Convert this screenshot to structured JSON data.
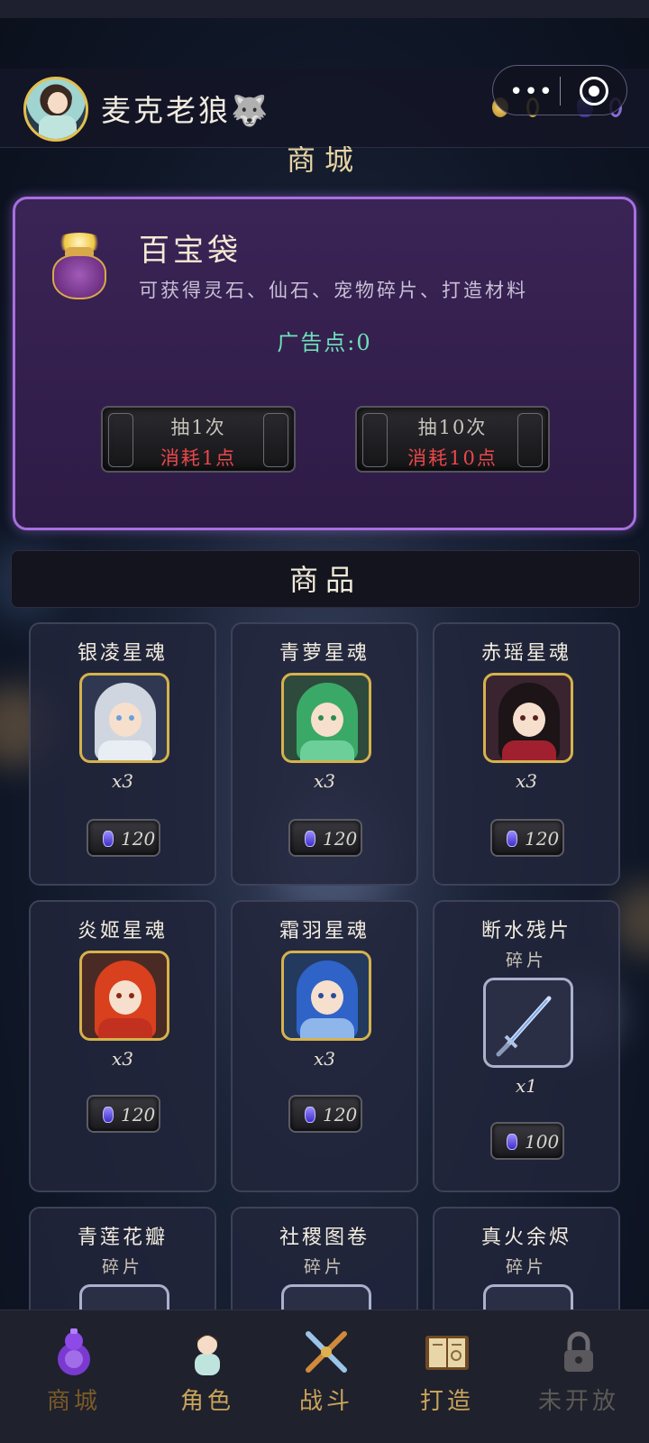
{
  "header": {
    "username": "麦克老狼🐺",
    "page_title": "商城"
  },
  "lucky_bag": {
    "title": "百宝袋",
    "description": "可获得灵石、仙石、宠物碎片、打造材料",
    "ad_points_label": "广告点:0",
    "draw_once": {
      "label": "抽1次",
      "cost": "消耗1点"
    },
    "draw_ten": {
      "label": "抽10次",
      "cost": "消耗10点"
    }
  },
  "goods": {
    "header": "商品",
    "items": [
      {
        "name": "银凌星魂",
        "qty": "x3",
        "price": "120",
        "hair": "#cfd6e0",
        "robe": "#e8eef4",
        "eye": "#6aa0d8"
      },
      {
        "name": "青萝星魂",
        "qty": "x3",
        "price": "120",
        "hair": "#3aa968",
        "robe": "#6ccf9a",
        "eye": "#2f8a4e"
      },
      {
        "name": "赤瑶星魂",
        "qty": "x3",
        "price": "120",
        "hair": "#1c1416",
        "robe": "#a02030",
        "eye": "#5a2020"
      },
      {
        "name": "炎姬星魂",
        "qty": "x3",
        "price": "120",
        "hair": "#d8401e",
        "robe": "#c23020",
        "eye": "#8a2a12"
      },
      {
        "name": "霜羽星魂",
        "qty": "x3",
        "price": "120",
        "hair": "#2f63c8",
        "robe": "#8fb6ea",
        "eye": "#2a4c9a"
      },
      {
        "name": "断水残片",
        "sub": "碎片",
        "qty": "x1",
        "price": "100"
      },
      {
        "name": "青莲花瓣",
        "sub": "碎片"
      },
      {
        "name": "社稷图卷",
        "sub": "碎片"
      },
      {
        "name": "真火余烬",
        "sub": "碎片"
      }
    ]
  },
  "bottom_nav": [
    {
      "label": "商城",
      "icon": "gourd-icon",
      "color": "#7a5a28"
    },
    {
      "label": "角色",
      "icon": "character-icon",
      "color": "#c9a45a"
    },
    {
      "label": "战斗",
      "icon": "crossed-swords-icon",
      "color": "#c9a45a"
    },
    {
      "label": "打造",
      "icon": "book-icon",
      "color": "#c9a45a"
    },
    {
      "label": "未开放",
      "icon": "lock-icon",
      "color": "#5c5a56"
    }
  ]
}
